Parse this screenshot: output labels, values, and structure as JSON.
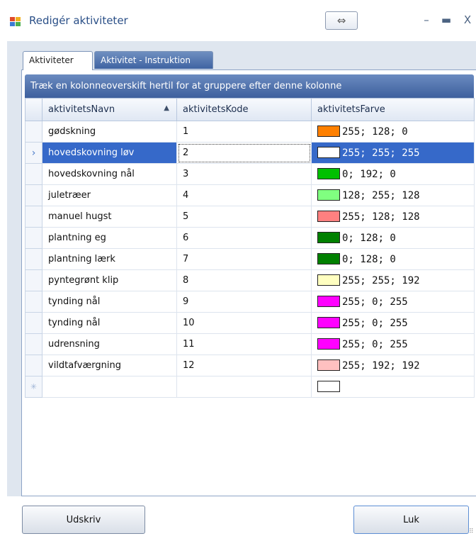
{
  "window": {
    "title": "Redigér aktiviteter",
    "swap_glyph": "⇔",
    "min_glyph": "–",
    "max_glyph": "▬",
    "close_glyph": "X"
  },
  "tabs": [
    {
      "label": "Aktiviteter",
      "active": true
    },
    {
      "label": "Aktivitet - Instruktion",
      "active": false
    }
  ],
  "grid": {
    "group_panel_text": "Træk en kolonneoverskift hertil for at gruppere efter denne kolonne",
    "columns": [
      "aktivitetsNavn",
      "aktivitetsKode",
      "aktivitetsFarve"
    ],
    "sort_indicator": "▲",
    "current_row_glyph": "›",
    "new_row_glyph": "✳",
    "rows": [
      {
        "name": "gødskning",
        "code": "1",
        "color_text": "255; 128; 0",
        "color_hex": "#ff8000"
      },
      {
        "name": "hovedskovning løv",
        "code": "2",
        "color_text": "255; 255; 255",
        "color_hex": "#ffffff"
      },
      {
        "name": "hovedskovning nål",
        "code": "3",
        "color_text": "0; 192; 0",
        "color_hex": "#00c000"
      },
      {
        "name": "juletræer",
        "code": "4",
        "color_text": "128; 255; 128",
        "color_hex": "#80ff80"
      },
      {
        "name": "manuel hugst",
        "code": "5",
        "color_text": "255; 128; 128",
        "color_hex": "#ff8080"
      },
      {
        "name": "plantning eg",
        "code": "6",
        "color_text": "0; 128; 0",
        "color_hex": "#008000"
      },
      {
        "name": "plantning lærk",
        "code": "7",
        "color_text": "0; 128; 0",
        "color_hex": "#008000"
      },
      {
        "name": "pyntegrønt klip",
        "code": "8",
        "color_text": "255; 255; 192",
        "color_hex": "#ffffc0"
      },
      {
        "name": "tynding nål",
        "code": "9",
        "color_text": "255; 0; 255",
        "color_hex": "#ff00ff"
      },
      {
        "name": "tynding nål",
        "code": "10",
        "color_text": "255; 0; 255",
        "color_hex": "#ff00ff"
      },
      {
        "name": "udrensning",
        "code": "11",
        "color_text": "255; 0; 255",
        "color_hex": "#ff00ff"
      },
      {
        "name": "vildtafværgning",
        "code": "12",
        "color_text": "255; 192; 192",
        "color_hex": "#ffc0c0"
      }
    ],
    "selected_index": 1
  },
  "buttons": {
    "print_label": "Udskriv",
    "close_label": "Luk"
  }
}
